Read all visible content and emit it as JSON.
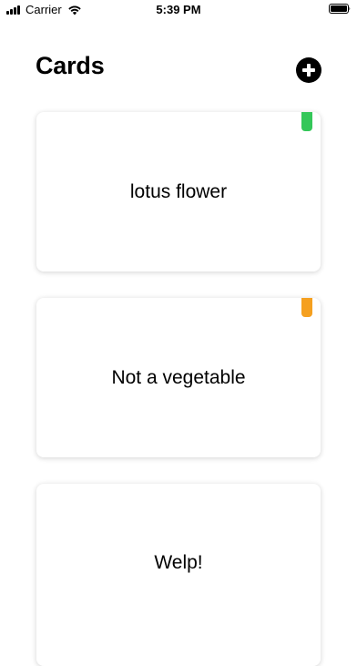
{
  "status_bar": {
    "carrier": "Carrier",
    "time": "5:39 PM",
    "icons": [
      "signal-icon",
      "wifi-icon",
      "battery-icon"
    ]
  },
  "header": {
    "title": "Cards",
    "add_button_icon": "plus-circle-icon"
  },
  "cards": [
    {
      "text": "lotus flower",
      "tag_color": "#34c759"
    },
    {
      "text": "Not a vegetable",
      "tag_color": "#f5a020"
    },
    {
      "text": "Welp!",
      "tag_color": null
    }
  ],
  "colors": {
    "background": "#ffffff",
    "text": "#000000",
    "green_tag": "#34c759",
    "orange_tag": "#f5a020"
  }
}
